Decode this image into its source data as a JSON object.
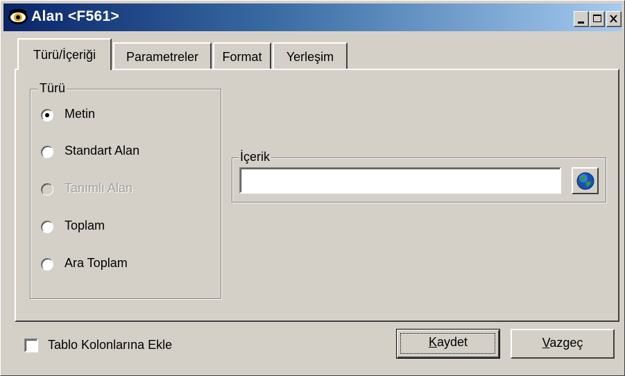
{
  "window": {
    "title": "Alan <F561>",
    "app_icon": "eye-icon",
    "controls": [
      "minimize-icon",
      "maximize-icon",
      "close-icon"
    ]
  },
  "tabs": [
    {
      "label": "Türü/İçeriği",
      "active": true
    },
    {
      "label": "Parametreler",
      "active": false
    },
    {
      "label": "Format",
      "active": false
    },
    {
      "label": "Yerleşim",
      "active": false
    }
  ],
  "type_group": {
    "label": "Türü",
    "options": [
      {
        "label": "Metin",
        "checked": true,
        "enabled": true
      },
      {
        "label": "Standart Alan",
        "checked": false,
        "enabled": true
      },
      {
        "label": "Tanımlı Alan",
        "checked": false,
        "enabled": false
      },
      {
        "label": "Toplam",
        "checked": false,
        "enabled": true
      },
      {
        "label": "Ara Toplam",
        "checked": false,
        "enabled": true
      }
    ]
  },
  "content_group": {
    "label": "İçerik",
    "value": "",
    "button_icon": "globe-icon"
  },
  "footer": {
    "checkbox_label": "Tablo Kolonlarına Ekle",
    "checkbox_checked": false,
    "save": {
      "prefix": "",
      "accel": "K",
      "rest": "aydet"
    },
    "cancel": {
      "prefix": "",
      "accel": "V",
      "rest": "azgeç"
    }
  }
}
